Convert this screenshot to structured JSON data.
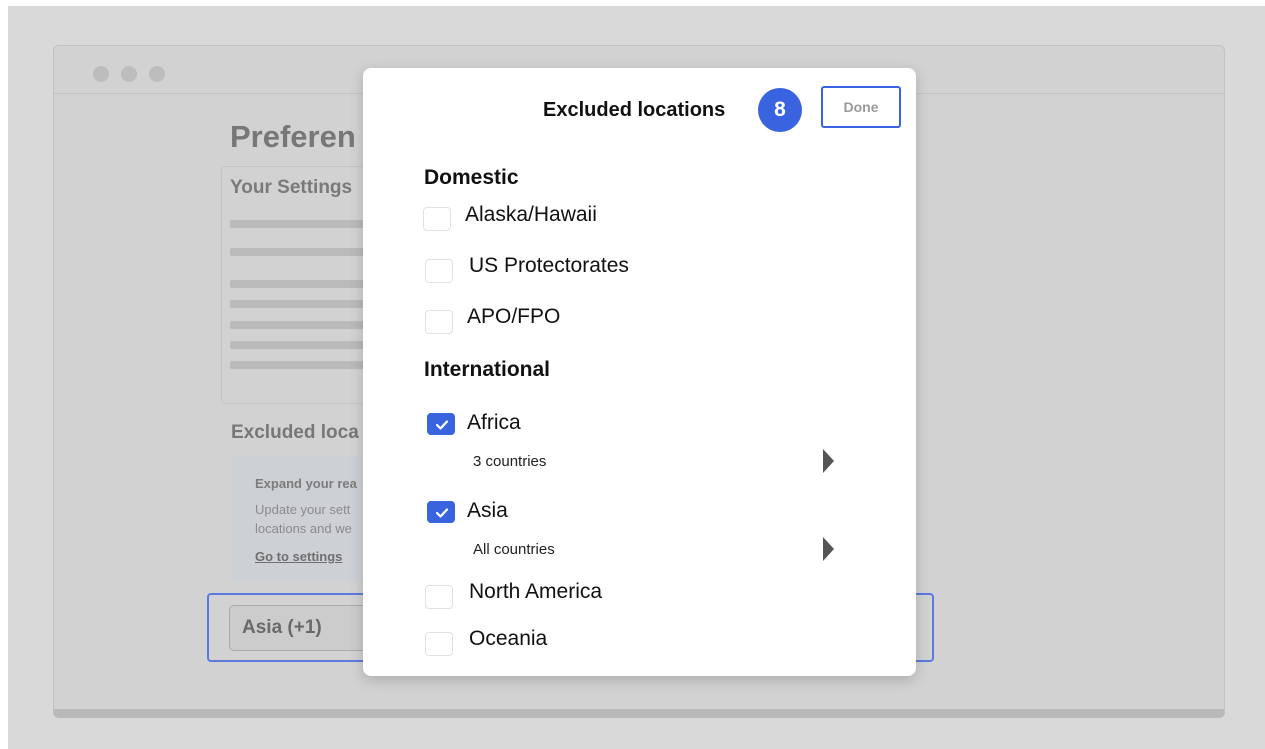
{
  "page": {
    "title": "Preferen",
    "settings_card_title": "Your Settings",
    "excluded_heading": "Excluded loca",
    "info_box": {
      "title": "Expand your rea",
      "line1": "Update your sett",
      "line2": "locations and we",
      "link": "Go to settings"
    },
    "selected_value": "Asia (+1)"
  },
  "modal": {
    "title": "Excluded locations",
    "step_badge": "8",
    "done_label": "Done",
    "domestic_heading": "Domestic",
    "domestic_items": [
      {
        "label": "Alaska/Hawaii",
        "checked": false
      },
      {
        "label": "US Protectorates",
        "checked": false
      },
      {
        "label": "APO/FPO",
        "checked": false
      }
    ],
    "international_heading": "International",
    "international_items": [
      {
        "label": "Africa",
        "checked": true,
        "sub": "3 countries"
      },
      {
        "label": "Asia",
        "checked": true,
        "sub": "All countries"
      },
      {
        "label": "North America",
        "checked": false
      },
      {
        "label": "Oceania",
        "checked": false
      }
    ]
  },
  "colors": {
    "accent": "#3a63e0",
    "overlay_bg": "#d2d2d2"
  }
}
